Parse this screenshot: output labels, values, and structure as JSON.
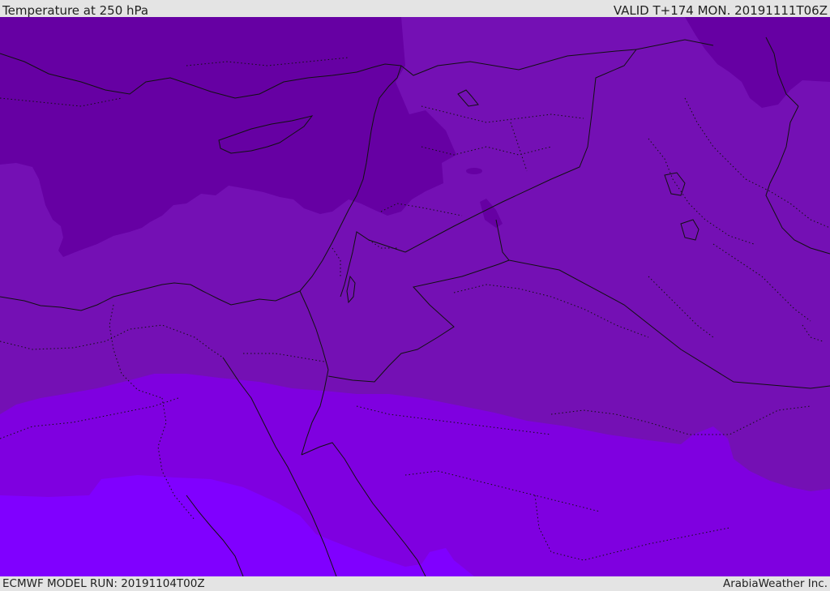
{
  "header": {
    "title": "Temperature at 250 hPa",
    "valid": "VALID T+174 MON. 20191111T06Z"
  },
  "footer": {
    "model_run": "ECMWF MODEL RUN: 20191104T00Z",
    "credit": "ArabiaWeather Inc."
  },
  "map": {
    "colors": {
      "band_coldest": "#6600a3",
      "band_cold": "#7410b4",
      "band_mid": "#7f00e0",
      "band_warm": "#8000ff",
      "coastline": "#111111",
      "border": "#111111"
    }
  }
}
